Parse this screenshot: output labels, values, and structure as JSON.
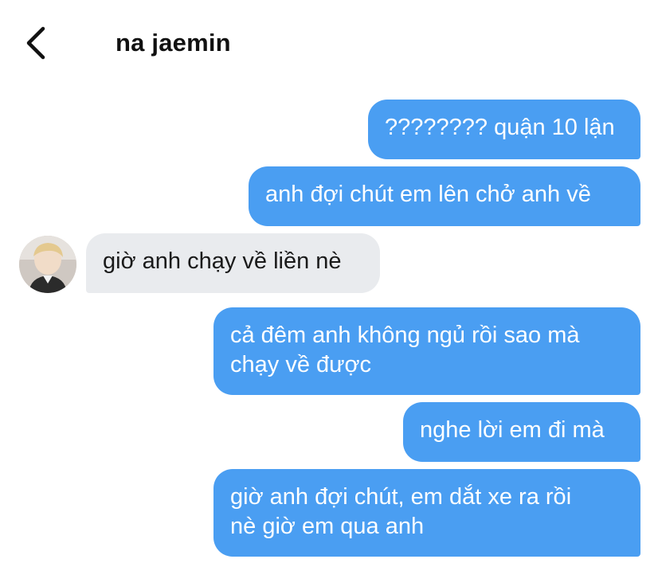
{
  "header": {
    "back_icon": "chevron-left-icon",
    "title": "na jaemin"
  },
  "colors": {
    "outgoing_bubble": "#4a9ef2",
    "incoming_bubble": "#e9ebee",
    "background": "#ffffff"
  },
  "messages": [
    {
      "direction": "outgoing",
      "lines": [
        "???????? quận 10 lận"
      ]
    },
    {
      "direction": "outgoing",
      "lines": [
        "anh đợi chút em lên chở anh về"
      ]
    },
    {
      "direction": "incoming",
      "lines": [
        "giờ anh chạy về liền nè"
      ],
      "avatar": "contact-avatar"
    },
    {
      "direction": "outgoing",
      "lines": [
        "cả đêm anh không ngủ rồi sao mà",
        "chạy về được"
      ]
    },
    {
      "direction": "outgoing",
      "lines": [
        "nghe lời em đi mà"
      ]
    },
    {
      "direction": "outgoing",
      "lines": [
        "giờ anh đợi chút, em dắt xe ra rồi",
        "nè giờ em qua anh"
      ]
    }
  ]
}
